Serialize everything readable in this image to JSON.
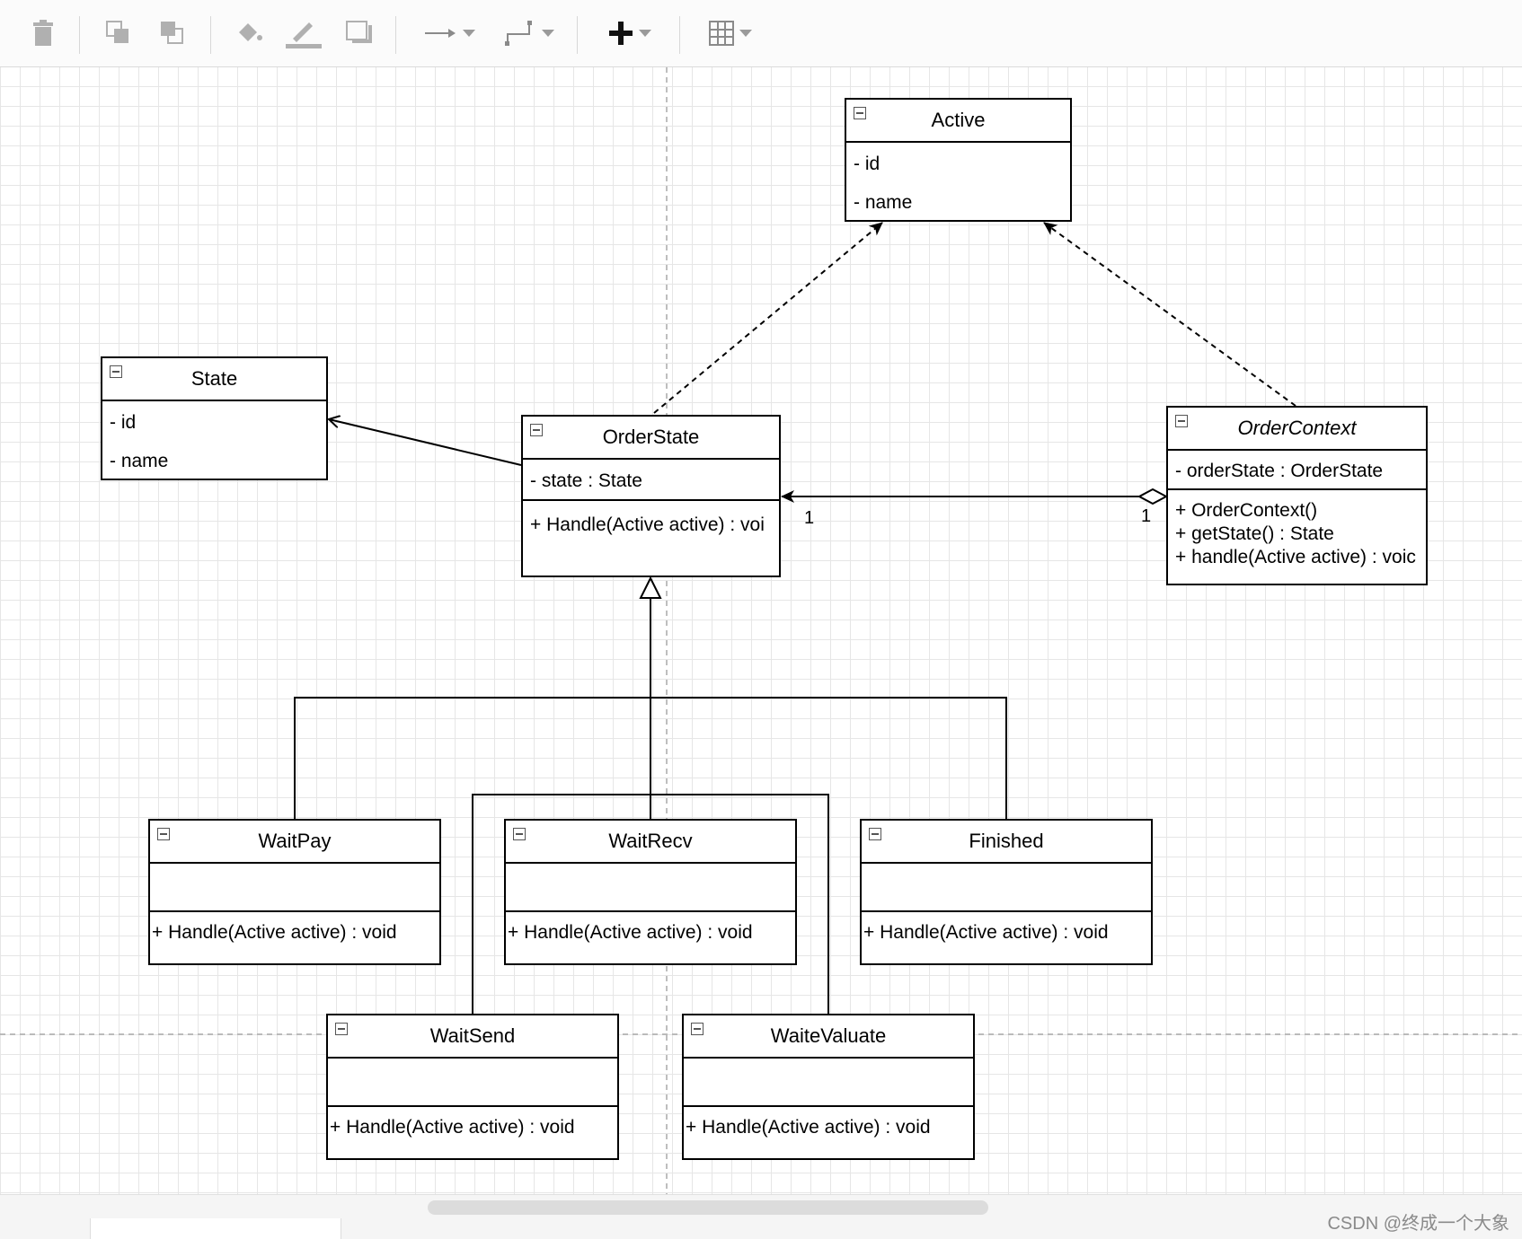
{
  "toolbar": {
    "icons": [
      "trash-icon",
      "to-front-icon",
      "to-back-icon",
      "fill-color-icon",
      "line-color-icon",
      "shadow-icon",
      "connection-arrow-icon",
      "waypoints-icon",
      "insert-plus-icon",
      "table-icon"
    ]
  },
  "diagram": {
    "active": {
      "title": "Active",
      "attrs": [
        "- id",
        "- name"
      ]
    },
    "state": {
      "title": "State",
      "attrs": [
        "- id",
        "- name"
      ]
    },
    "orderstate": {
      "title": "OrderState",
      "attrs": [
        "- state : State"
      ],
      "methods": [
        "+ Handle(Active active) : voi"
      ]
    },
    "ordercontext": {
      "title": "OrderContext",
      "attrs": [
        "- orderState : OrderState"
      ],
      "methods": [
        "+ OrderContext()",
        "+ getState() : State",
        "+ handle(Active active) : voic"
      ]
    },
    "waitpay": {
      "title": "WaitPay",
      "methods": [
        "+ Handle(Active active) : void"
      ]
    },
    "waitrecv": {
      "title": "WaitRecv",
      "methods": [
        "+ Handle(Active active) : void"
      ]
    },
    "finished": {
      "title": "Finished",
      "methods": [
        "+ Handle(Active active) : void"
      ]
    },
    "waitsend": {
      "title": "WaitSend",
      "methods": [
        "+ Handle(Active active) : void"
      ]
    },
    "waitevaluate": {
      "title": "WaiteValuate",
      "methods": [
        "+ Handle(Active active) : void"
      ]
    },
    "multiplicity": {
      "left": "1",
      "right": "1"
    }
  },
  "watermark": "CSDN @终成一个大象"
}
